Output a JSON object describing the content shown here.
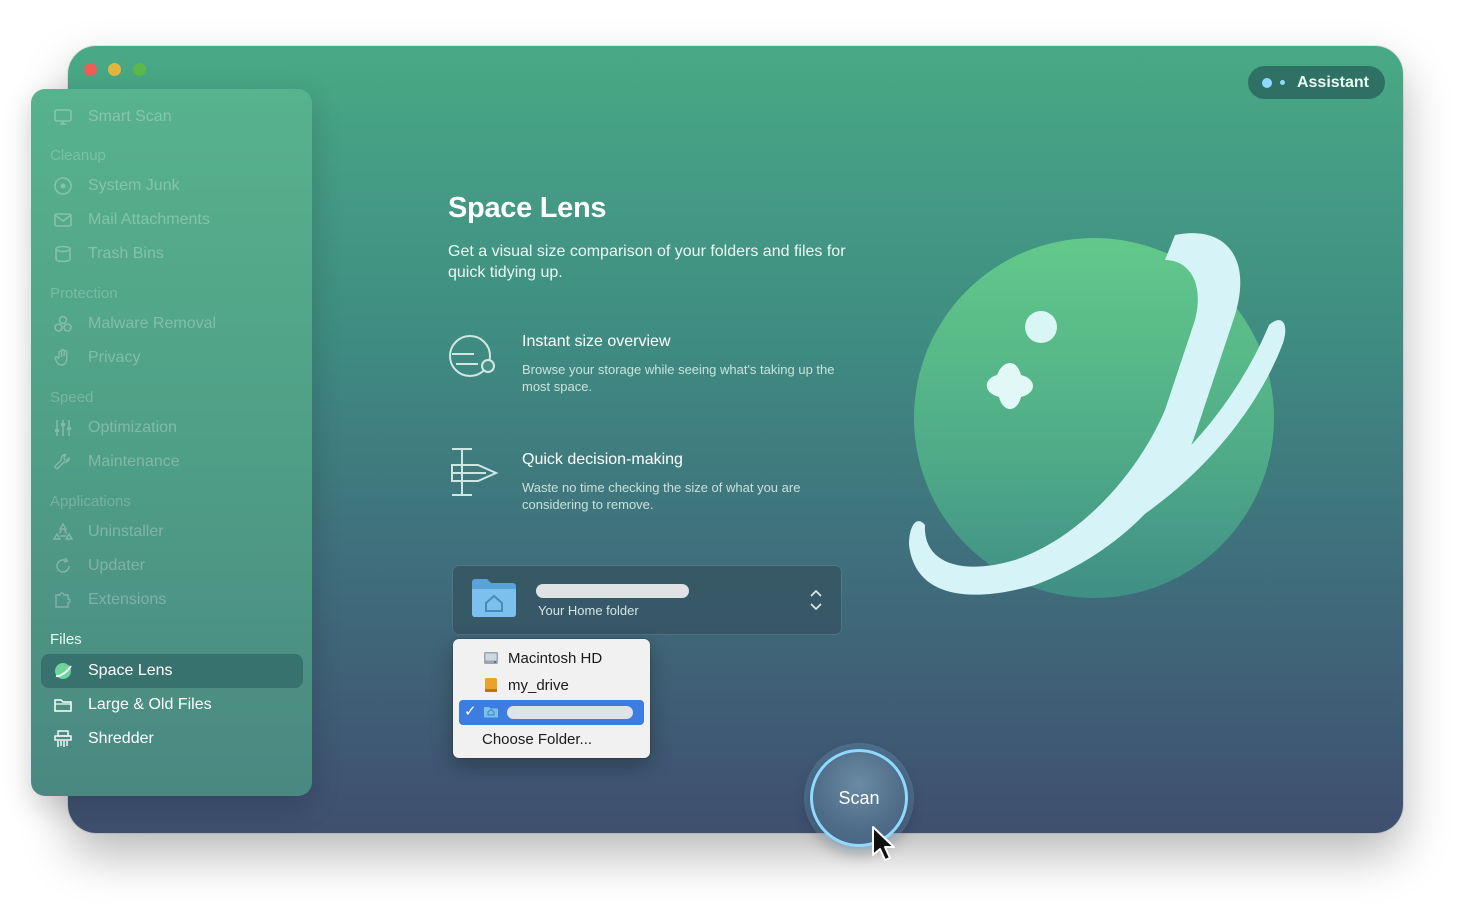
{
  "window": {
    "assistant_label": "Assistant"
  },
  "sidebar": {
    "top_item": {
      "label": "Smart Scan",
      "icon": "monitor-icon"
    },
    "sections": [
      {
        "heading": "Cleanup",
        "items": [
          {
            "label": "System Junk",
            "icon": "disk-icon"
          },
          {
            "label": "Mail Attachments",
            "icon": "envelope-icon"
          },
          {
            "label": "Trash Bins",
            "icon": "trash-icon"
          }
        ]
      },
      {
        "heading": "Protection",
        "items": [
          {
            "label": "Malware Removal",
            "icon": "biohazard-icon"
          },
          {
            "label": "Privacy",
            "icon": "hand-icon"
          }
        ]
      },
      {
        "heading": "Speed",
        "items": [
          {
            "label": "Optimization",
            "icon": "sliders-icon"
          },
          {
            "label": "Maintenance",
            "icon": "wrench-icon"
          }
        ]
      },
      {
        "heading": "Applications",
        "items": [
          {
            "label": "Uninstaller",
            "icon": "apps-icon"
          },
          {
            "label": "Updater",
            "icon": "update-icon"
          },
          {
            "label": "Extensions",
            "icon": "puzzle-icon"
          }
        ]
      },
      {
        "heading": "Files",
        "items": [
          {
            "label": "Space Lens",
            "icon": "space-lens-icon",
            "active": true
          },
          {
            "label": "Large & Old Files",
            "icon": "folder-icon"
          },
          {
            "label": "Shredder",
            "icon": "shredder-icon"
          }
        ]
      }
    ]
  },
  "main": {
    "title": "Space Lens",
    "subtitle": "Get a visual size comparison of your folders and files for quick tidying up.",
    "features": [
      {
        "title": "Instant size overview",
        "description": "Browse your storage while seeing what's taking up the most space.",
        "icon": "size-overview-icon"
      },
      {
        "title": "Quick decision-making",
        "description": "Waste no time checking the size of what you are considering to remove.",
        "icon": "decision-icon"
      }
    ],
    "folder_select": {
      "label": "Your Home folder",
      "icon": "home-folder-icon"
    },
    "dropdown": {
      "items": [
        {
          "label": "Macintosh HD",
          "icon": "hard-drive-icon"
        },
        {
          "label": "my_drive",
          "icon": "external-drive-icon"
        },
        {
          "label": "",
          "icon": "home-folder-icon",
          "selected": true
        },
        {
          "label": "Choose Folder..."
        }
      ]
    },
    "scan_label": "Scan"
  },
  "colors": {
    "accent": "#8fd9ff",
    "selection": "#3d7de1",
    "window_top": "#49a985",
    "window_bottom": "#3f4f6f"
  }
}
